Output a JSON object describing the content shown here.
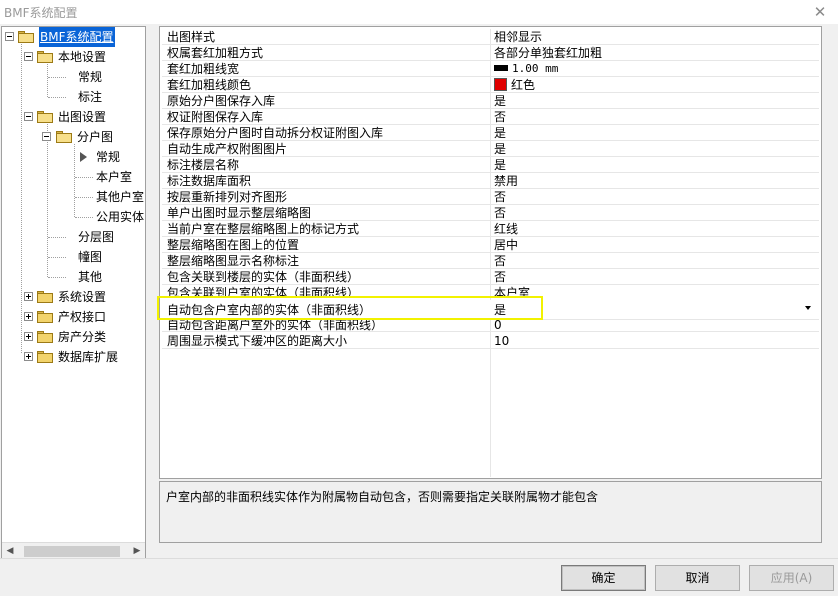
{
  "window": {
    "title": "BMF系统配置",
    "close_glyph": "✕"
  },
  "tree": {
    "root": "BMF系统配置",
    "local": "本地设置",
    "local_regular": "常规",
    "local_mark": "标注",
    "output": "出图设置",
    "unit_map": "分户图",
    "unit_regular": "常规",
    "this_unit": "本户室",
    "other_unit": "其他户室",
    "common_entity": "公用实体",
    "layer_map": "分层图",
    "building_map": "幢图",
    "other": "其他",
    "system": "系统设置",
    "rights": "产权接口",
    "property": "房产分类",
    "database": "数据库扩展",
    "scroll_left": "◀",
    "scroll_right": "▶"
  },
  "properties": [
    {
      "name": "出图样式",
      "value": "相邻显示"
    },
    {
      "name": "权属套红加粗方式",
      "value": "各部分单独套红加粗"
    },
    {
      "name": "套红加粗线宽",
      "value": "1.00 mm"
    },
    {
      "name": "套红加粗线颜色",
      "value": "红色"
    },
    {
      "name": "原始分户图保存入库",
      "value": "是"
    },
    {
      "name": "权证附图保存入库",
      "value": "否"
    },
    {
      "name": "保存原始分户图时自动拆分权证附图入库",
      "value": "是"
    },
    {
      "name": "自动生成产权附图图片",
      "value": "是"
    },
    {
      "name": "标注楼层名称",
      "value": "是"
    },
    {
      "name": "标注数据库面积",
      "value": "禁用"
    },
    {
      "name": "按层重新排列对齐图形",
      "value": "否"
    },
    {
      "name": "单户出图时显示整层缩略图",
      "value": "否"
    },
    {
      "name": "当前户室在整层缩略图上的标记方式",
      "value": "红线"
    },
    {
      "name": "整层缩略图在图上的位置",
      "value": "居中"
    },
    {
      "name": "整层缩略图显示名称标注",
      "value": "否"
    },
    {
      "name": "包含关联到楼层的实体（非面积线）",
      "value": "否"
    },
    {
      "name": "包含关联到户室的实体（非面积线）",
      "value": "本户室"
    },
    {
      "name": "自动包含户室内部的实体（非面积线）",
      "value": "是"
    },
    {
      "name": "自动包含距离户室外的实体（非面积线）",
      "value": "0"
    },
    {
      "name": "周围显示模式下缓冲区的距离大小",
      "value": "10"
    }
  ],
  "colors": {
    "highlight": "#f2f200",
    "selection": "#0a64d7",
    "swatch_red": "#e00000"
  },
  "description": "户室内部的非面积线实体作为附属物自动包含，否则需要指定关联附属物才能包含",
  "buttons": {
    "ok": "确定",
    "cancel": "取消",
    "apply": "应用(A)"
  }
}
